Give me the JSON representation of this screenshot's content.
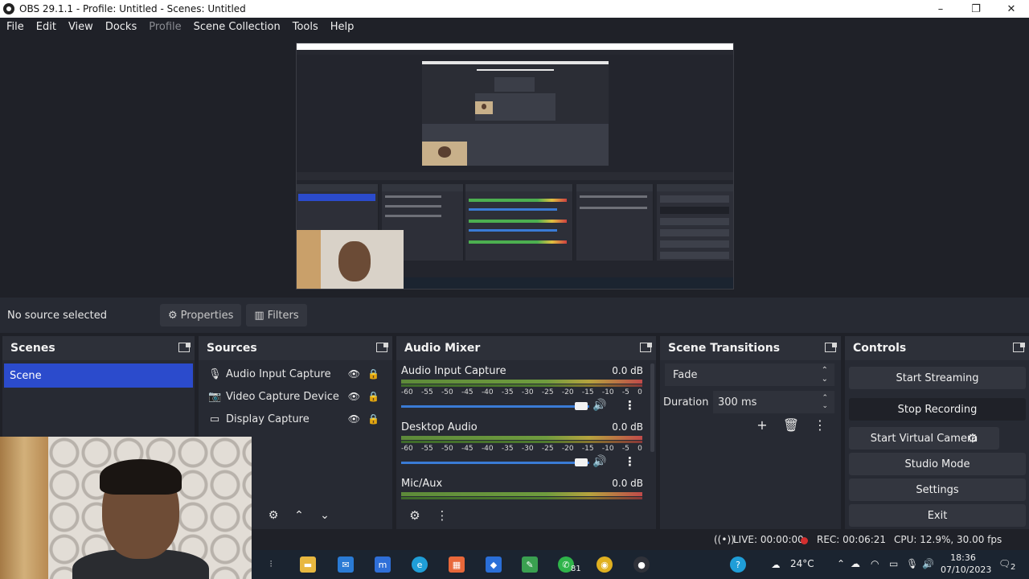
{
  "window": {
    "title": "OBS 29.1.1 - Profile: Untitled - Scenes: Untitled",
    "minimize": "–",
    "maximize": "❐",
    "close": "✕"
  },
  "menu": [
    "File",
    "Edit",
    "View",
    "Docks",
    "Profile",
    "Scene Collection",
    "Tools",
    "Help"
  ],
  "source_toolbar": {
    "no_source": "No source selected",
    "properties": "Properties",
    "filters": "Filters"
  },
  "scenes": {
    "title": "Scenes",
    "items": [
      "Scene"
    ]
  },
  "sources": {
    "title": "Sources",
    "items": [
      {
        "label": "Audio Input Capture",
        "icon": "microphone-icon"
      },
      {
        "label": "Video Capture Device",
        "icon": "camera-icon"
      },
      {
        "label": "Display Capture",
        "icon": "monitor-icon"
      }
    ]
  },
  "mixer": {
    "title": "Audio Mixer",
    "channels": [
      {
        "name": "Audio Input Capture",
        "db": "0.0 dB",
        "volume": 1.0
      },
      {
        "name": "Desktop Audio",
        "db": "0.0 dB",
        "volume": 1.0
      },
      {
        "name": "Mic/Aux",
        "db": "0.0 dB",
        "volume": 1.0
      }
    ],
    "ticks": [
      "-60",
      "-55",
      "-50",
      "-45",
      "-40",
      "-35",
      "-30",
      "-25",
      "-20",
      "-15",
      "-10",
      "-5",
      "0"
    ]
  },
  "transitions": {
    "title": "Scene Transitions",
    "selected": "Fade",
    "duration_label": "Duration",
    "duration_value": "300 ms"
  },
  "controls": {
    "title": "Controls",
    "start_streaming": "Start Streaming",
    "stop_recording": "Stop Recording",
    "start_virtual_camera": "Start Virtual Camera",
    "studio_mode": "Studio Mode",
    "settings": "Settings",
    "exit": "Exit"
  },
  "status": {
    "live": "LIVE: 00:00:00",
    "rec": "REC: 00:06:21",
    "cpu": "CPU: 12.9%, 30.00 fps"
  },
  "taskbar": {
    "whatsapp_badge": "81",
    "temperature": "24°C",
    "time": "18:36",
    "date": "07/10/2023",
    "notifications": "2"
  },
  "colors": {
    "background": "#1f2128",
    "dock": "#272a33",
    "selection": "#2b4bcc",
    "recording": "#d32f2f"
  }
}
